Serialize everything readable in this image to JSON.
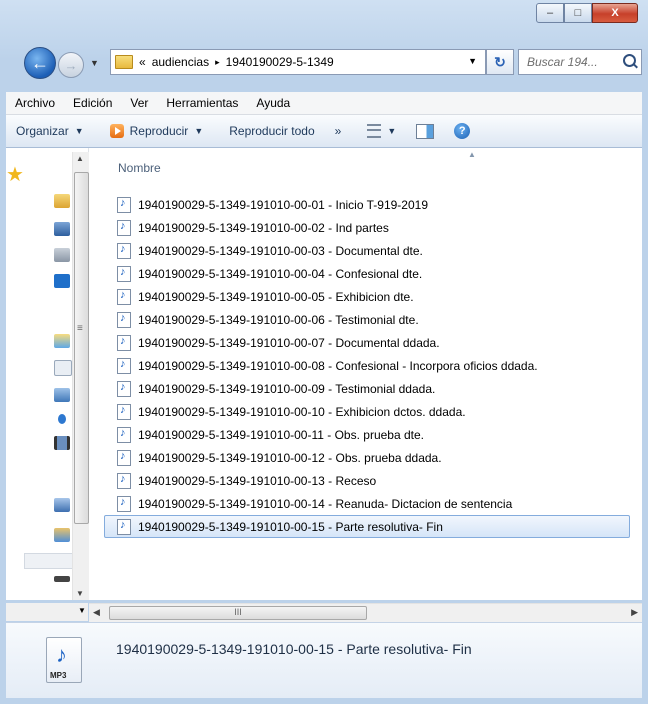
{
  "window": {
    "minimize_glyph": "–",
    "maximize_glyph": "□",
    "close_glyph": "X"
  },
  "address": {
    "overflow": "«",
    "crumbs": [
      "audiencias",
      "1940190029-5-1349"
    ],
    "separator": "▸",
    "search_placeholder": "Buscar 194..."
  },
  "menu": [
    "Archivo",
    "Edición",
    "Ver",
    "Herramientas",
    "Ayuda"
  ],
  "toolbar": {
    "organize": "Organizar",
    "play": "Reproducir",
    "play_all": "Reproducir todo",
    "more": "»",
    "help": "?"
  },
  "list": {
    "column_name": "Nombre",
    "files": [
      "1940190029-5-1349-191010-00-01 - Inicio T-919-2019",
      "1940190029-5-1349-191010-00-02 - Ind partes",
      "1940190029-5-1349-191010-00-03 - Documental dte.",
      "1940190029-5-1349-191010-00-04 - Confesional dte.",
      "1940190029-5-1349-191010-00-05 - Exhibicion  dte.",
      "1940190029-5-1349-191010-00-06 - Testimonial dte.",
      "1940190029-5-1349-191010-00-07 - Documental ddada.",
      "1940190029-5-1349-191010-00-08 - Confesional - Incorpora oficios ddada.",
      "1940190029-5-1349-191010-00-09 - Testimonial ddada.",
      "1940190029-5-1349-191010-00-10 - Exhibicion dctos. ddada.",
      "1940190029-5-1349-191010-00-11 - Obs. prueba dte.",
      "1940190029-5-1349-191010-00-12 - Obs. prueba ddada.",
      "1940190029-5-1349-191010-00-13 - Receso",
      "1940190029-5-1349-191010-00-14 - Reanuda- Dictacion de sentencia",
      "1940190029-5-1349-191010-00-15 - Parte resolutiva- Fin"
    ],
    "selected_index": 14
  },
  "details": {
    "title": "1940190029-5-1349-191010-00-15 - Parte resolutiva- Fin",
    "icon_label": "MP3"
  },
  "hscroll": {
    "grip": "III"
  }
}
